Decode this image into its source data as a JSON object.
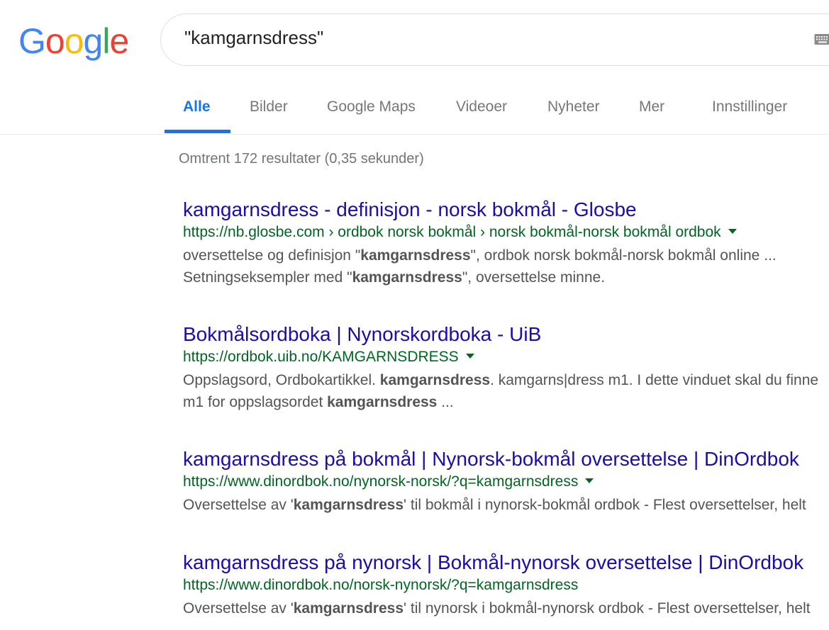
{
  "logo": {
    "letters": [
      "G",
      "o",
      "o",
      "g",
      "l",
      "e"
    ],
    "colors": [
      "#4285F4",
      "#EA4335",
      "#FBBC05",
      "#4285F4",
      "#34A853",
      "#EA4335"
    ]
  },
  "search": {
    "query": "\"kamgarnsdress\"",
    "keyboard_icon": "keyboard-icon"
  },
  "tabs": [
    {
      "label": "Alle",
      "active": true
    },
    {
      "label": "Bilder"
    },
    {
      "label": "Google Maps"
    },
    {
      "label": "Videoer"
    },
    {
      "label": "Nyheter"
    },
    {
      "label": "Mer"
    },
    {
      "label": "Innstillinger"
    }
  ],
  "stats": "Omtrent 172 resultater (0,35 sekunder)",
  "colors": {
    "accent": "#1a73e8",
    "link": "#1a0dab",
    "url": "#006621",
    "snippet": "#545454"
  },
  "results": [
    {
      "title": "kamgarnsdress - definisjon - norsk bokmål - Glosbe",
      "url": "https://nb.glosbe.com › ordbok norsk bokmål › norsk bokmål-norsk bokmål ordbok",
      "snippet_lines": [
        [
          {
            "t": "oversettelse og definisjon \""
          },
          {
            "t": "kamgarnsdress",
            "b": true
          },
          {
            "t": "\", ordbok norsk bokmål-norsk bokmål online ..."
          }
        ],
        [
          {
            "t": "Setningseksempler med \""
          },
          {
            "t": "kamgarnsdress",
            "b": true
          },
          {
            "t": "\", oversettelse minne."
          }
        ]
      ]
    },
    {
      "title": "Bokmålsordboka | Nynorskordboka - UiB",
      "url": "https://ordbok.uib.no/KAMGARNSDRESS",
      "snippet_lines": [
        [
          {
            "t": "Oppslagsord, Ordbokartikkel. "
          },
          {
            "t": "kamgarnsdress",
            "b": true
          },
          {
            "t": ". kamgarns|dress m1. I dette vinduet skal du finne"
          }
        ],
        [
          {
            "t": "m1 for oppslagsordet "
          },
          {
            "t": "kamgarnsdress",
            "b": true
          },
          {
            "t": " ..."
          }
        ]
      ]
    },
    {
      "title": "kamgarnsdress på bokmål | Nynorsk-bokmål oversettelse | DinOrdbok",
      "url": "https://www.dinordbok.no/nynorsk-norsk/?q=kamgarnsdress",
      "snippet_lines": [
        [
          {
            "t": "Oversettelse av '"
          },
          {
            "t": "kamgarnsdress",
            "b": true
          },
          {
            "t": "' til bokmål i nynorsk-bokmål ordbok - Flest oversettelser, helt"
          }
        ]
      ]
    },
    {
      "title": "kamgarnsdress på nynorsk | Bokmål-nynorsk oversettelse | DinOrdbok",
      "url": "https://www.dinordbok.no/norsk-nynorsk/?q=kamgarnsdress",
      "snippet_lines": [
        [
          {
            "t": "Oversettelse av '"
          },
          {
            "t": "kamgarnsdress",
            "b": true
          },
          {
            "t": "' til nynorsk i bokmål-nynorsk ordbok - Flest oversettelser, helt"
          }
        ]
      ]
    }
  ]
}
